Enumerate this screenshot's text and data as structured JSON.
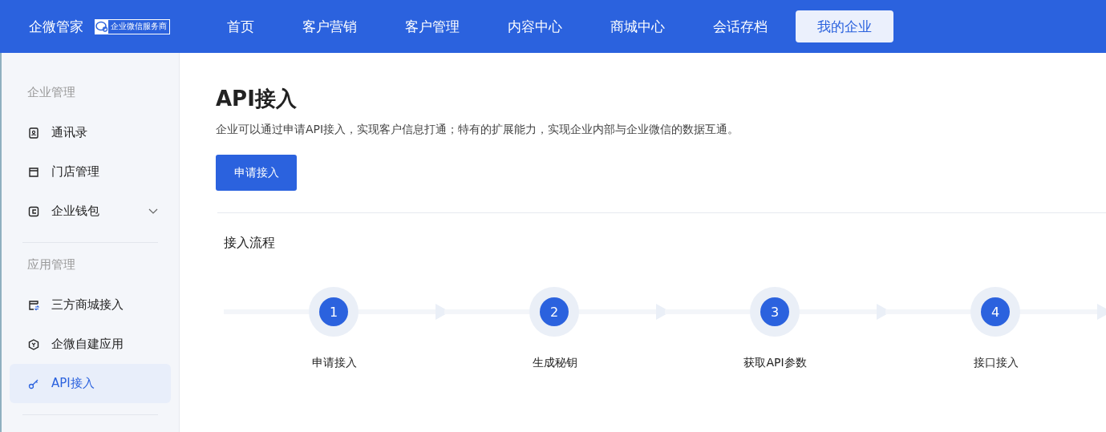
{
  "brand": {
    "name": "企微管家",
    "badge": "企业微信服务商"
  },
  "nav": [
    {
      "label": "首页",
      "selected": false
    },
    {
      "label": "客户营销",
      "selected": false
    },
    {
      "label": "客户管理",
      "selected": false
    },
    {
      "label": "内容中心",
      "selected": false
    },
    {
      "label": "商城中心",
      "selected": false
    },
    {
      "label": "会话存档",
      "selected": false
    },
    {
      "label": "我的企业",
      "selected": true
    }
  ],
  "sidebar": [
    {
      "title": "企业管理",
      "items": [
        {
          "label": "通讯录",
          "kind": "contacts",
          "selected": false
        },
        {
          "label": "门店管理",
          "kind": "store",
          "selected": false
        },
        {
          "label": "企业钱包",
          "kind": "wallet",
          "selected": false,
          "expanded": false
        }
      ]
    },
    {
      "title": "应用管理",
      "items": [
        {
          "label": "三方商城接入",
          "kind": "mall",
          "selected": false
        },
        {
          "label": "企微自建应用",
          "kind": "app",
          "selected": false
        },
        {
          "label": "API接入",
          "kind": "key",
          "selected": true
        }
      ]
    }
  ],
  "page": {
    "title": "API接入",
    "description": "企业可以通过申请API接入，实现客户信息打通；特有的扩展能力，实现企业内部与企业微信的数据互通。",
    "button": "申请接入",
    "section": "接入流程",
    "steps": [
      {
        "number": "1",
        "label": "申请接入"
      },
      {
        "number": "2",
        "label": "生成秘钥"
      },
      {
        "number": "3",
        "label": "获取API参数"
      },
      {
        "number": "4",
        "label": "接口接入"
      }
    ]
  }
}
